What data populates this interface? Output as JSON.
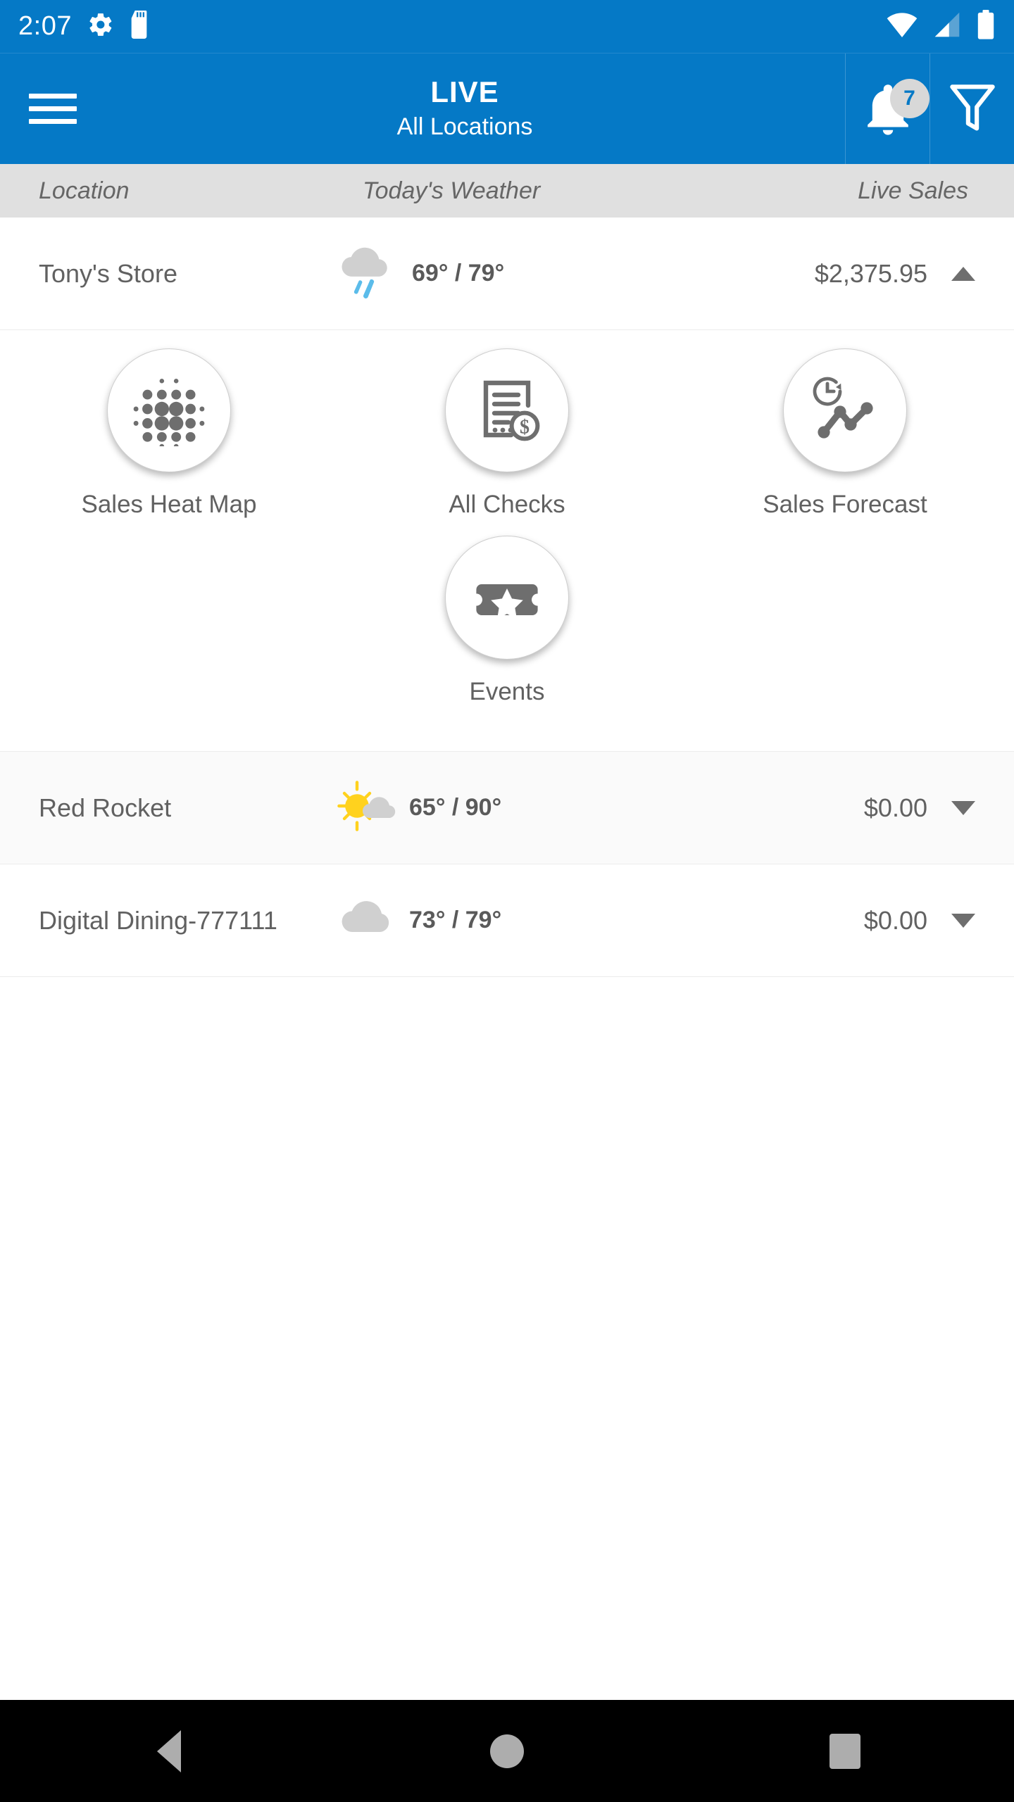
{
  "status_bar": {
    "time": "2:07",
    "icons": [
      "gear-icon",
      "sd-card-icon",
      "wifi-icon",
      "cellular-signal-icon",
      "battery-icon"
    ]
  },
  "header": {
    "menu_icon": "hamburger-menu-icon",
    "title": "LIVE",
    "subtitle": "All Locations",
    "notification_icon": "bell-icon",
    "notification_count": "7",
    "filter_icon": "filter-funnel-icon",
    "background_color": "#0579C6"
  },
  "columns": {
    "location": "Location",
    "weather": "Today's Weather",
    "sales": "Live Sales"
  },
  "rows": [
    {
      "name": "Tony's Store",
      "weather_icon": "rain-cloud-icon",
      "temps": "69° / 79°",
      "low": "69°",
      "high": "79°",
      "sales": "$2,375.95",
      "expanded": true,
      "caret": "chevron-up-icon"
    },
    {
      "name": "Red Rocket",
      "weather_icon": "partly-sunny-icon",
      "temps": "65° / 90°",
      "low": "65°",
      "high": "90°",
      "sales": "$0.00",
      "expanded": false,
      "caret": "chevron-down-icon"
    },
    {
      "name": "Digital Dining-777111",
      "weather_icon": "cloudy-icon",
      "temps": "73° / 79°",
      "low": "73°",
      "high": "79°",
      "sales": "$0.00",
      "expanded": false,
      "caret": "chevron-down-icon"
    }
  ],
  "expanded_tiles": [
    {
      "label": "Sales Heat Map",
      "icon": "heat-map-dots-icon"
    },
    {
      "label": "All Checks",
      "icon": "receipt-dollar-icon"
    },
    {
      "label": "Sales Forecast",
      "icon": "forecast-chart-clock-icon"
    },
    {
      "label": "Events",
      "icon": "ticket-star-icon"
    }
  ],
  "navbar": {
    "back": "back-triangle-icon",
    "home": "home-circle-icon",
    "recents": "recents-square-icon"
  },
  "colors": {
    "accent": "#0579C6",
    "column_header_bg": "#E0E0E0",
    "text_gray": "#616161",
    "alt_row_bg": "#FAFAFA",
    "icon_gray": "#6E6E6E",
    "sun_yellow": "#FFD21E",
    "rain_blue": "#5BBCEA",
    "cloud_gray": "#D0D0D0"
  }
}
